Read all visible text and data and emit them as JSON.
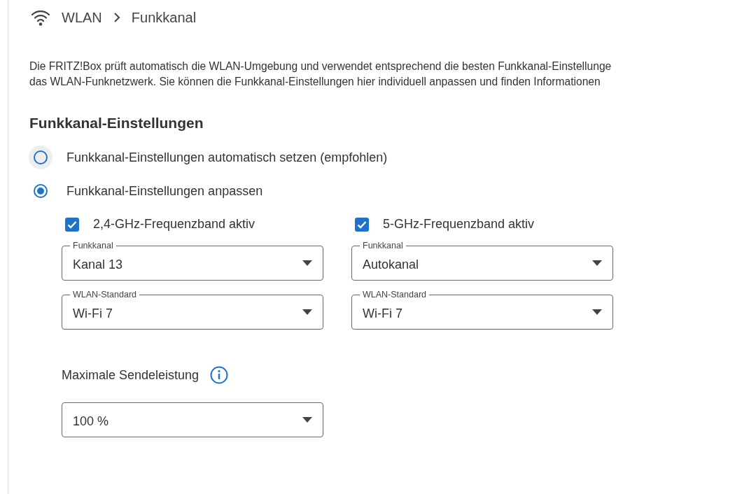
{
  "breadcrumb": [
    "WLAN",
    "Funkkanal"
  ],
  "intro_lines": [
    "Die FRITZ!Box prüft automatisch die WLAN-Umgebung und verwendet entsprechend die besten Funkkanal-Einstellunge",
    "das WLAN-Funknetzwerk. Sie können die Funkkanal-Einstellungen hier individuell anpassen und finden Informationen"
  ],
  "section_title": "Funkkanal-Einstellungen",
  "radios": [
    {
      "label": "Funkkanal-Einstellungen automatisch setzen (empfohlen)",
      "selected": false,
      "focused": true
    },
    {
      "label": "Funkkanal-Einstellungen anpassen",
      "selected": true,
      "focused": false
    }
  ],
  "bands": [
    {
      "label": "2,4-GHz-Frequenzband aktiv",
      "checked": true,
      "fields": [
        {
          "legend": "Funkkanal",
          "value": "Kanal 13"
        },
        {
          "legend": "WLAN-Standard",
          "value": "Wi-Fi 7"
        }
      ]
    },
    {
      "label": "5-GHz-Frequenzband aktiv",
      "checked": true,
      "fields": [
        {
          "legend": "Funkkanal",
          "value": "Autokanal"
        },
        {
          "legend": "WLAN-Standard",
          "value": "Wi-Fi 7"
        }
      ]
    }
  ],
  "power": {
    "label": "Maximale Sendeleistung",
    "value": "100 %"
  }
}
